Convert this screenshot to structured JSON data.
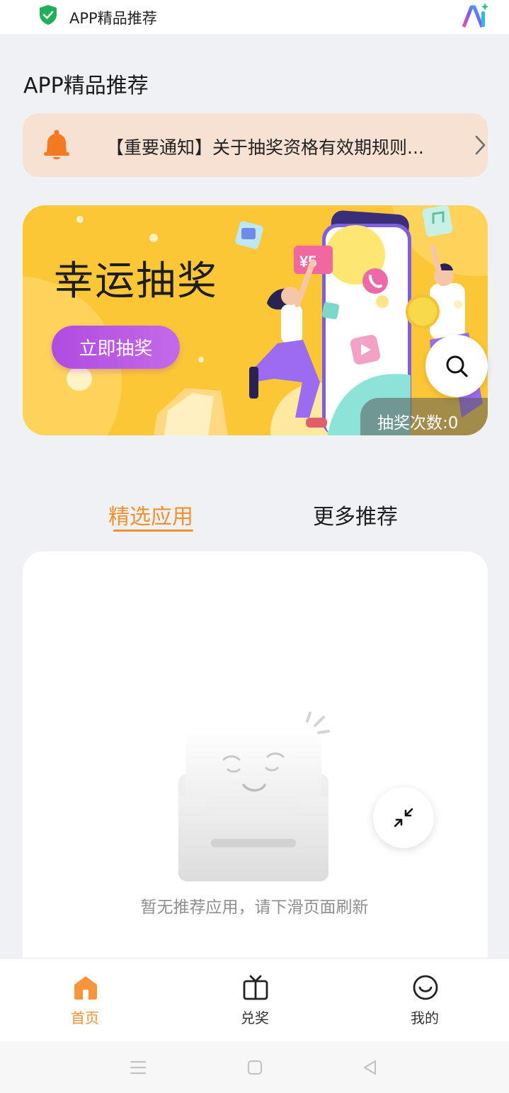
{
  "status_bar": {
    "app_title": "APP精品推荐"
  },
  "page": {
    "title": "APP精品推荐"
  },
  "notice": {
    "text": "【重要通知】关于抽奖资格有效期规则..."
  },
  "banner": {
    "headline": "幸运抽奖",
    "cta_label": "立即抽奖",
    "price_tag": "¥5",
    "draw_count": "抽奖次数:0"
  },
  "tabs": [
    {
      "label": "精选应用",
      "active": true
    },
    {
      "label": "更多推荐",
      "active": false
    }
  ],
  "empty_state": {
    "message": "暂无推荐应用，请下滑页面刷新"
  },
  "bottom_nav": [
    {
      "label": "首页",
      "icon": "home-icon",
      "active": true
    },
    {
      "label": "兑奖",
      "icon": "tv-gift-icon",
      "active": false
    },
    {
      "label": "我的",
      "icon": "smiley-icon",
      "active": false
    }
  ],
  "colors": {
    "accent": "#f0902e",
    "banner_bg": "#fcc737",
    "cta": "#b04be0",
    "notice_bg": "#f6e1d3"
  }
}
